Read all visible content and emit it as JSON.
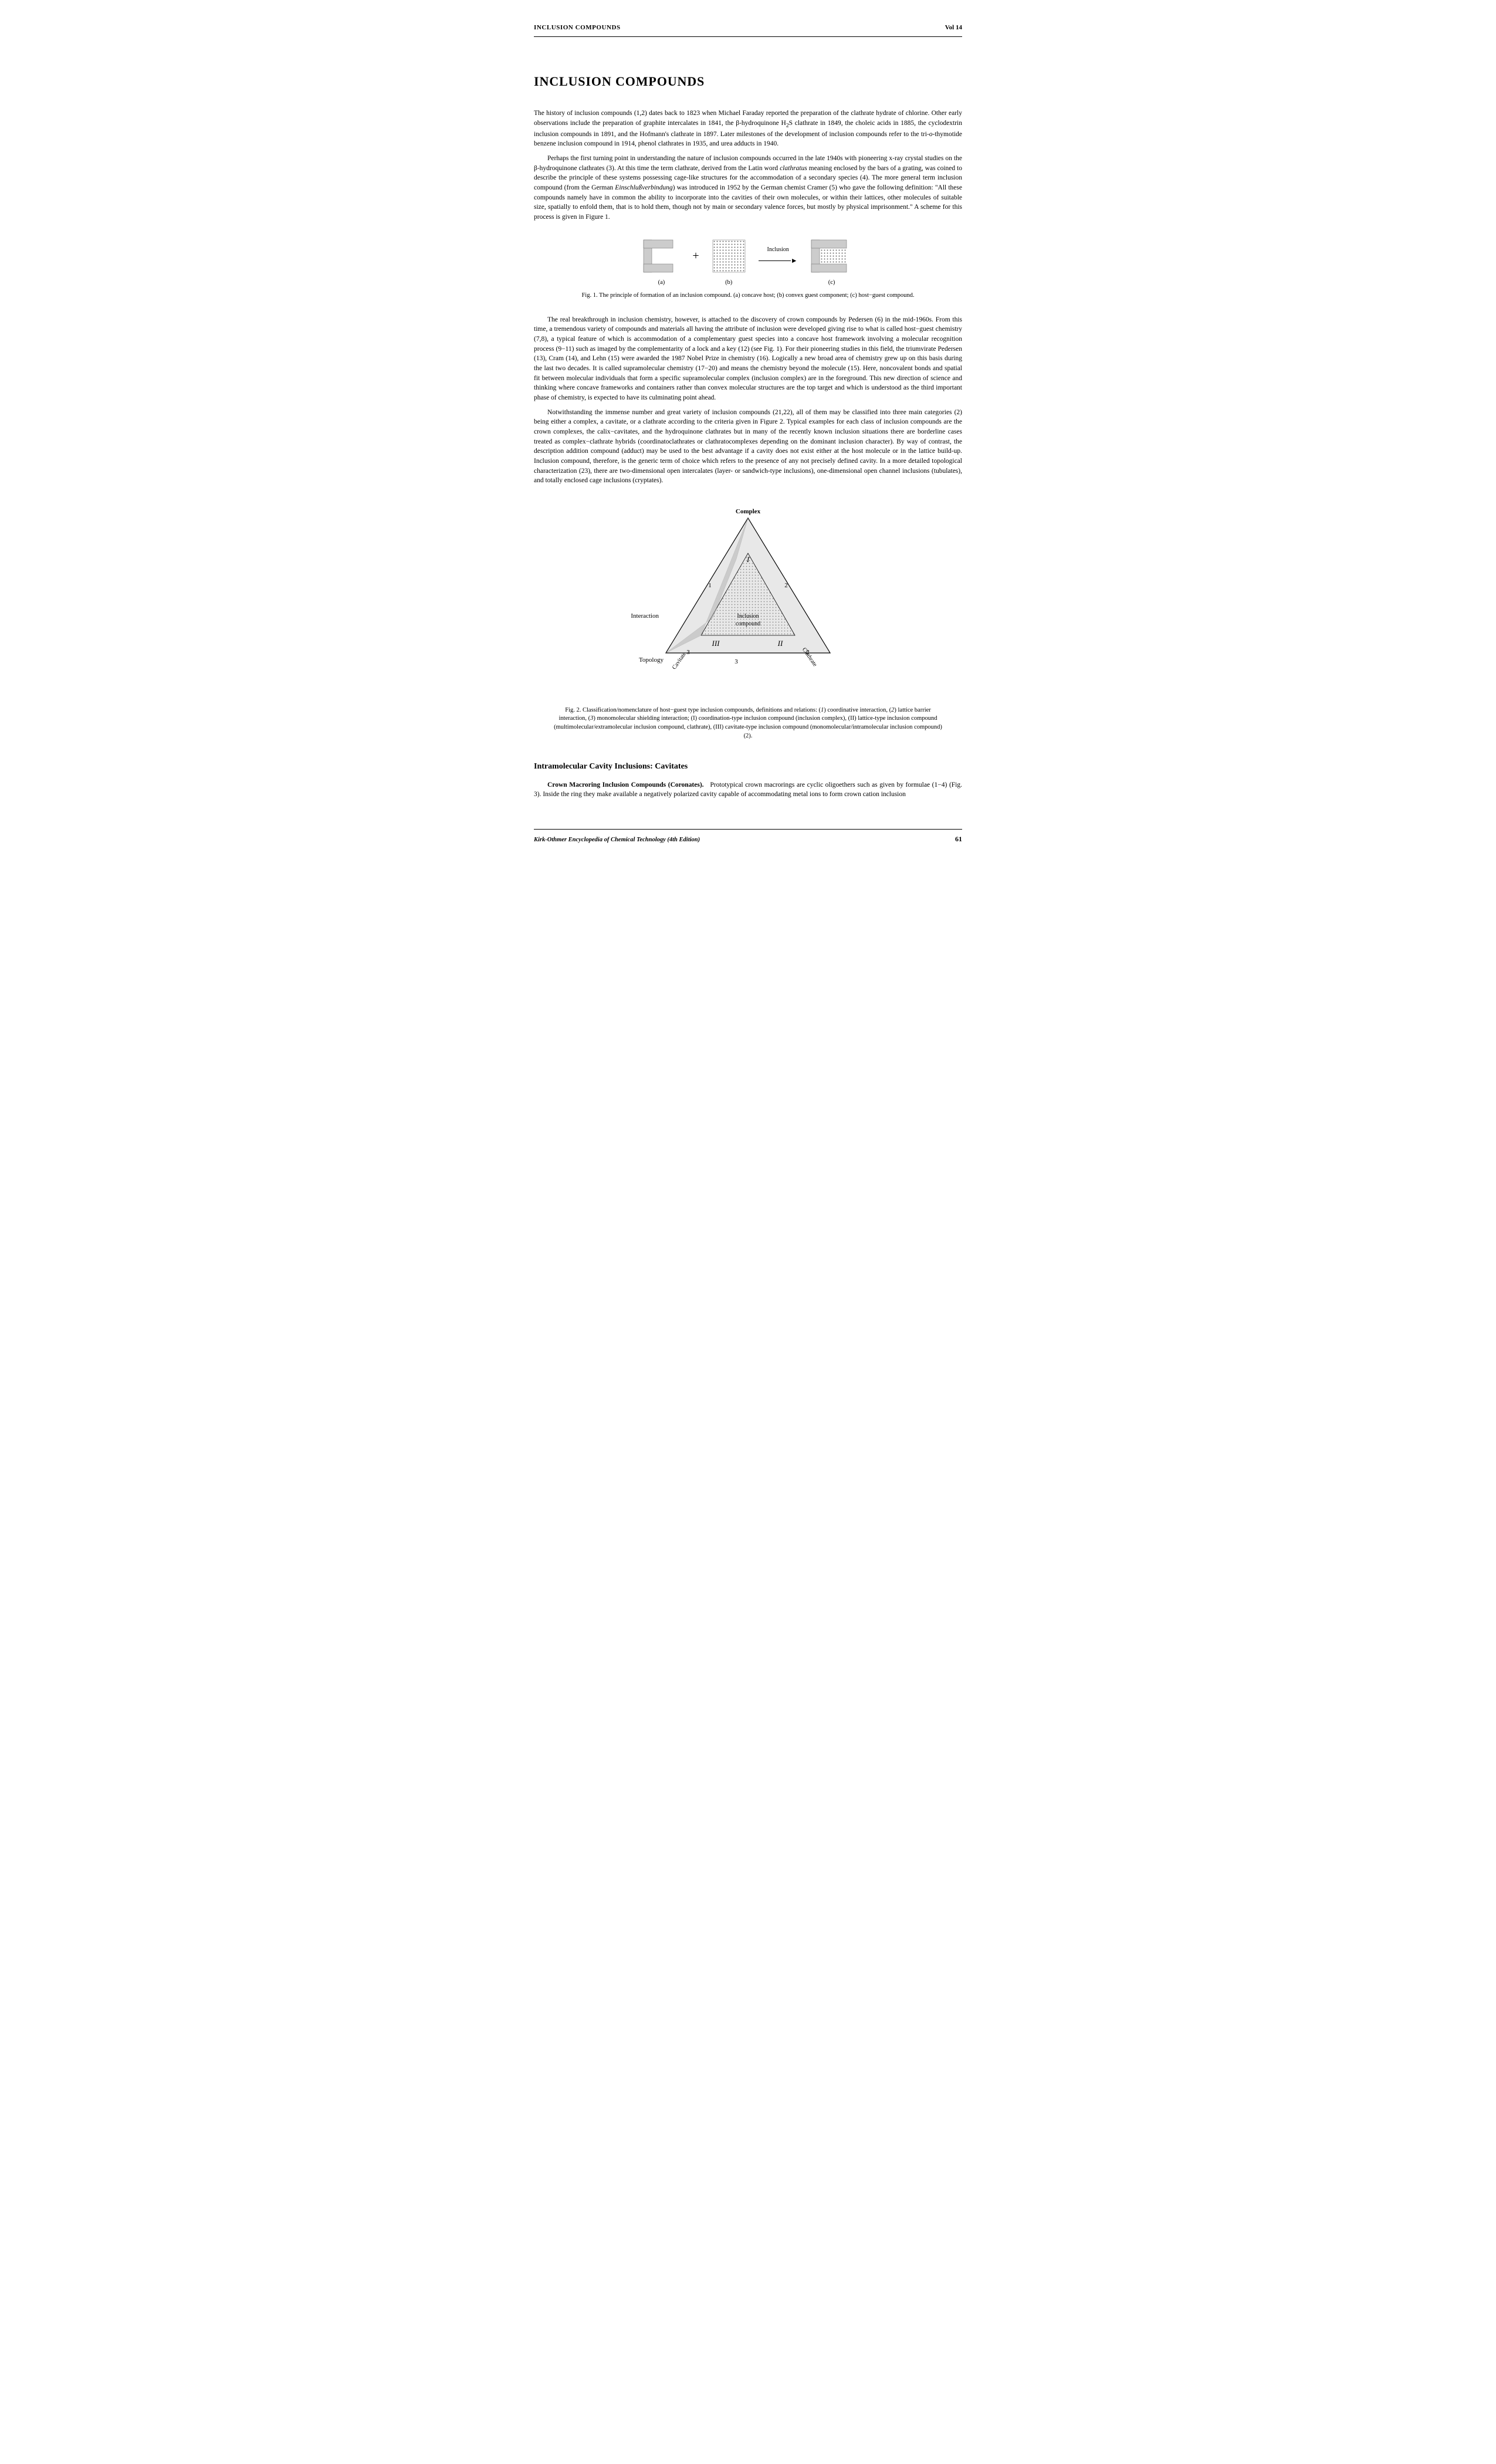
{
  "header": {
    "title": "INCLUSION COMPOUNDS",
    "vol": "Vol 14"
  },
  "article": {
    "title": "INCLUSION COMPOUNDS",
    "paragraphs": [
      {
        "indent": false,
        "text": "The history of inclusion compounds (1,2) dates back to 1823 when Michael Faraday reported the preparation of the clathrate hydrate of chlorine. Other early observations include the preparation of graphite intercalates in 1841, the β-hydroquinone H₂S clathrate in 1849, the choleic acids in 1885, the cyclodextrin inclusion compounds in 1891, and the Hofmann's clathrate in 1897. Later milestones of the development of inclusion compounds refer to the tri-o-thymotide benzene inclusion compound in 1914, phenol clathrates in 1935, and urea adducts in 1940."
      },
      {
        "indent": true,
        "text": "Perhaps the first turning point in understanding the nature of inclusion compounds occurred in the late 1940s with pioneering x-ray crystal studies on the β-hydroquinone clathrates (3). At this time the term clathrate, derived from the Latin word clathratus meaning enclosed by the bars of a grating, was coined to describe the principle of these systems possessing cage-like structures for the accommodation of a secondary species (4). The more general term inclusion compound (from the German Einschlußverbindung) was introduced in 1952 by the German chemist Cramer (5) who gave the following definition: \"All these compounds namely have in common the ability to incorporate into the cavities of their own molecules, or within their lattices, other molecules of suitable size, spatially to enfold them, that is to hold them, though not by main or secondary valence forces, but mostly by physical imprisonment.\" A scheme for this process is given in Figure 1."
      }
    ],
    "figure1_caption": "Fig. 1. The principle of formation of an inclusion compound. (a) concave host; (b) convex guest component; (c) host−guest compound.",
    "paragraph2": [
      {
        "indent": true,
        "text": "The real breakthrough in inclusion chemistry, however, is attached to the discovery of crown compounds by Pedersen (6) in the mid-1960s. From this time, a tremendous variety of compounds and materials all having the attribute of inclusion were developed giving rise to what is called host−guest chemistry (7,8), a typical feature of which is accommodation of a complementary guest species into a concave host framework involving a molecular recognition process (9−11) such as imaged by the complementarity of a lock and a key (12) (see Fig. 1). For their pioneering studies in this field, the triumvirate Pedersen (13), Cram (14), and Lehn (15) were awarded the 1987 Nobel Prize in chemistry (16). Logically a new broad area of chemistry grew up on this basis during the last two decades. It is called supramolecular chemistry (17−20) and means the chemistry beyond the molecule (15). Here, noncovalent bonds and spatial fit between molecular individuals that form a specific supramolecular complex (inclusion complex) are in the foreground. This new direction of science and thinking where concave frameworks and containers rather than convex molecular structures are the top target and which is understood as the third important phase of chemistry, is expected to have its culminating point ahead."
      },
      {
        "indent": true,
        "text": "Notwithstanding the immense number and great variety of inclusion compounds (21,22), all of them may be classified into three main categories (2) being either a complex, a cavitate, or a clathrate according to the criteria given in Figure 2. Typical examples for each class of inclusion compounds are the crown complexes, the calix−cavitates, and the hydroquinone clathrates but in many of the recently known inclusion situations there are borderline cases treated as complex−clathrate hybrids (coordinatoclathrates or clathratocomplexes depending on the dominant inclusion character). By way of contrast, the description addition compound (adduct) may be used to the best advantage if a cavity does not exist either at the host molecule or in the lattice build-up. Inclusion compound, therefore, is the generic term of choice which refers to the presence of any not precisely defined cavity. In a more detailed topological characterization (23), there are two-dimensional open intercalates (layer- or sandwich-type inclusions), one-dimensional open channel inclusions (tubulates), and totally enclosed cage inclusions (cryptates)."
      }
    ],
    "figure2_caption": "Fig. 2. Classification/nomenclature of host−guest type inclusion compounds, definitions and relations: (1) coordinative interaction, (2) lattice barrier interaction, (3) monomolecular shielding interaction; (I) coordination-type inclusion compound (inclusion complex), (II) lattice-type inclusion compound (multimolecular/extramolecular inclusion compound, clathrate), (III) cavitate-type inclusion compound (monomolecular/intramolecular inclusion compound) (2).",
    "section_heading": "Intramolecular Cavity Inclusions: Cavitates",
    "section_para": "Crown Macroring Inclusion Compounds (Coronates).   Prototypical crown macrorings are cyclic oligoethers such as given by formulae (1−4) (Fig. 3). Inside the ring they make available a negatively polarized cavity capable of accommodating metal ions to form crown cation inclusion"
  },
  "footer": {
    "encyclopedia": "Kirk-Othmer Encyclopedia of Chemical Technology (4th Edition)",
    "page": "61"
  },
  "figure1": {
    "parts": [
      "(a)",
      "(b)",
      "(c)"
    ],
    "arrow_label": "Inclusion",
    "plus": "+"
  },
  "figure2": {
    "labels": {
      "complex": "Complex",
      "interaction": "Interaction",
      "inclusion_compound": "Inclusion\ncompound",
      "topology": "Topology",
      "cavitate": "Cavitate",
      "clathrate": "Clathrate",
      "roman_I": "I",
      "roman_II": "II",
      "roman_III": "III",
      "num1": "1",
      "num2": "2",
      "num3": "3",
      "num2b": "2",
      "num3b": "3"
    }
  }
}
